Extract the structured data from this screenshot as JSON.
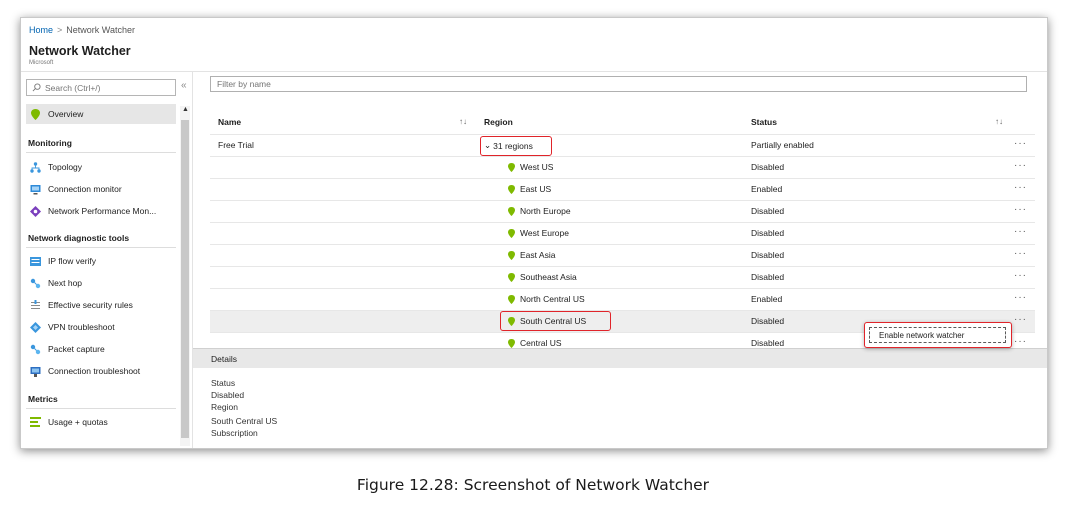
{
  "breadcrumb": {
    "home": "Home",
    "current": "Network Watcher"
  },
  "header": {
    "title": "Network Watcher",
    "subtitle": "Microsoft"
  },
  "sidebar": {
    "search_placeholder": "Search (Ctrl+/)",
    "collapse": "«",
    "overview": "Overview",
    "sections": {
      "monitoring": "Monitoring",
      "diagnostics": "Network diagnostic tools",
      "metrics": "Metrics"
    },
    "monitoring_items": [
      {
        "label": "Topology",
        "icon": "topology-icon"
      },
      {
        "label": "Connection monitor",
        "icon": "connection-monitor-icon"
      },
      {
        "label": "Network Performance Mon...",
        "icon": "performance-monitor-icon"
      }
    ],
    "diagnostic_items": [
      {
        "label": "IP flow verify",
        "icon": "ip-flow-icon"
      },
      {
        "label": "Next hop",
        "icon": "next-hop-icon"
      },
      {
        "label": "Effective security rules",
        "icon": "security-rules-icon"
      },
      {
        "label": "VPN troubleshoot",
        "icon": "vpn-icon"
      },
      {
        "label": "Packet capture",
        "icon": "packet-capture-icon"
      },
      {
        "label": "Connection troubleshoot",
        "icon": "connection-troubleshoot-icon"
      }
    ],
    "metrics_items": [
      {
        "label": "Usage + quotas",
        "icon": "usage-quotas-icon"
      }
    ]
  },
  "main": {
    "filter_placeholder": "Filter by name",
    "columns": {
      "name": "Name",
      "region": "Region",
      "status": "Status"
    },
    "subscription": {
      "name": "Free Trial",
      "region": "31 regions",
      "status": "Partially enabled"
    },
    "regions": [
      {
        "region": "West US",
        "status": "Disabled"
      },
      {
        "region": "East US",
        "status": "Enabled"
      },
      {
        "region": "North Europe",
        "status": "Disabled"
      },
      {
        "region": "West Europe",
        "status": "Disabled"
      },
      {
        "region": "East Asia",
        "status": "Disabled"
      },
      {
        "region": "Southeast Asia",
        "status": "Disabled"
      },
      {
        "region": "North Central US",
        "status": "Enabled"
      },
      {
        "region": "South Central US",
        "status": "Disabled"
      },
      {
        "region": "Central US",
        "status": "Disabled"
      }
    ],
    "more": "···",
    "context_menu": {
      "item": "Enable network watcher"
    }
  },
  "details": {
    "title": "Details",
    "lines": [
      "Status",
      "Disabled",
      "Region",
      "South Central US",
      "Subscription"
    ]
  },
  "caption": "Figure 12.28: Screenshot of Network Watcher",
  "colors": {
    "highlight": "#e0242a",
    "pin": "#7fba00",
    "link": "#0063b1"
  }
}
